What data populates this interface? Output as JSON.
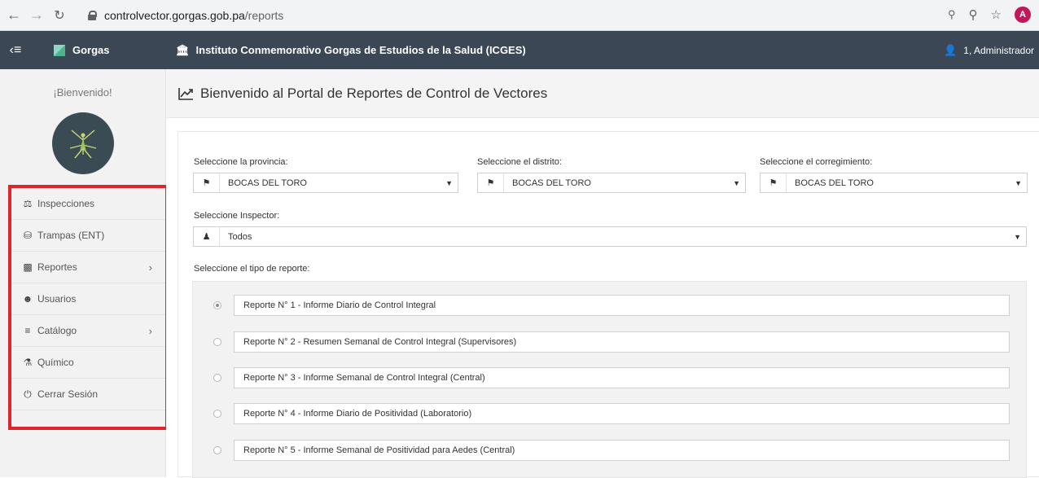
{
  "browser": {
    "url_host": "controlvector.gorgas.gob.pa",
    "url_path": "/reports",
    "profile_initial": "A",
    "icons": [
      "back-arrow-icon",
      "forward-arrow-icon",
      "reload-icon",
      "lock-icon",
      "key-icon",
      "zoom-icon",
      "star-icon"
    ]
  },
  "topbar": {
    "brand": "Gorgas",
    "institution": "Instituto Conmemorativo Gorgas de Estudios de la Salud (ICGES)",
    "user": "1, Administrador",
    "background": "#3b4754"
  },
  "sidebar": {
    "welcome": "¡Bienvenido!",
    "highlight_color": "#e0242b",
    "items": [
      {
        "label": "Inspecciones",
        "icon": "microscope-icon",
        "submenu": false
      },
      {
        "label": "Trampas (ENT)",
        "icon": "trap-icon",
        "submenu": false
      },
      {
        "label": "Reportes",
        "icon": "bar-chart-icon",
        "submenu": true
      },
      {
        "label": "Usuarios",
        "icon": "users-icon",
        "submenu": false
      },
      {
        "label": "Catálogo",
        "icon": "list-icon",
        "submenu": true
      },
      {
        "label": "Químico",
        "icon": "flask-icon",
        "submenu": false
      },
      {
        "label": "Cerrar Sesión",
        "icon": "power-icon",
        "submenu": false
      }
    ]
  },
  "main": {
    "title": "Bienvenido al Portal de Reportes de Control de Vectores",
    "provincia": {
      "label": "Seleccione la provincia:",
      "value": "BOCAS DEL TORO"
    },
    "distrito": {
      "label": "Seleccione el distrito:",
      "value": "BOCAS DEL TORO"
    },
    "corregimiento": {
      "label": "Seleccione el corregimiento:",
      "value": "BOCAS DEL TORO"
    },
    "inspector": {
      "label": "Seleccione Inspector:",
      "value": "Todos"
    },
    "report_type_label": "Seleccione el tipo de reporte:",
    "reports": [
      {
        "label": "Reporte N° 1 - Informe Diario de Control Integral",
        "checked": true
      },
      {
        "label": "Reporte N° 2 - Resumen Semanal de Control Integral (Supervisores)",
        "checked": false
      },
      {
        "label": "Reporte N° 3 - Informe Semanal de Control Integral (Central)",
        "checked": false
      },
      {
        "label": "Reporte N° 4 - Informe Diario de Positividad (Laboratorio)",
        "checked": false
      },
      {
        "label": "Reporte N° 5 - Informe Semanal de Positividad para Aedes (Central)",
        "checked": false
      }
    ]
  }
}
